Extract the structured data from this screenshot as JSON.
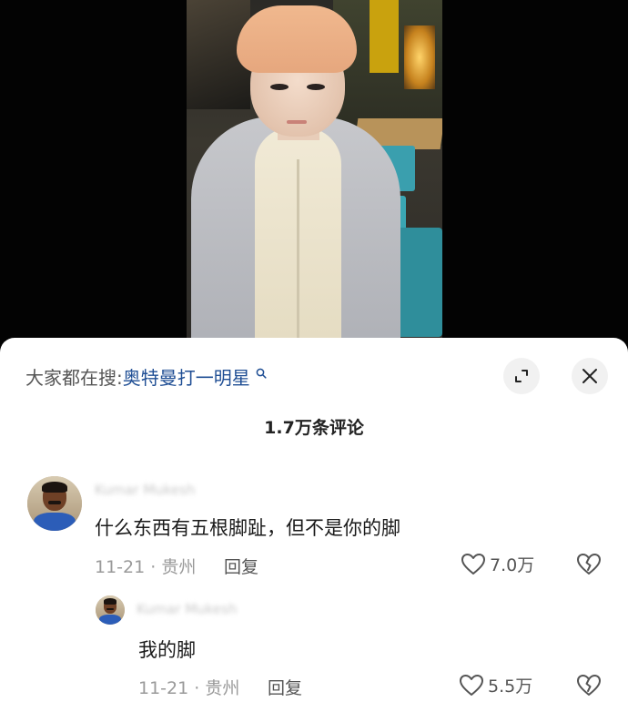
{
  "hot_search": {
    "prefix": "大家都在搜:",
    "query": "奥特曼打一明星",
    "icon": "search-icon"
  },
  "header_buttons": {
    "expand_icon": "expand-icon",
    "close_icon": "close-icon"
  },
  "comment_count": "1.7万条评论",
  "comments": [
    {
      "username": "Kumar Mukesh",
      "text": "什么东西有五根脚趾，但不是你的脚",
      "meta": "11-21 · 贵州",
      "reply_label": "回复",
      "likes": "7.0万",
      "replies": [
        {
          "username": "Kumar Mukesh",
          "text": "我的脚",
          "meta": "11-21 · 贵州",
          "reply_label": "回复",
          "likes": "5.5万"
        }
      ]
    }
  ],
  "colors": {
    "link_blue": "#1f4e94",
    "meta_gray": "#9a9a9a",
    "sheet_bg": "#ffffff"
  }
}
